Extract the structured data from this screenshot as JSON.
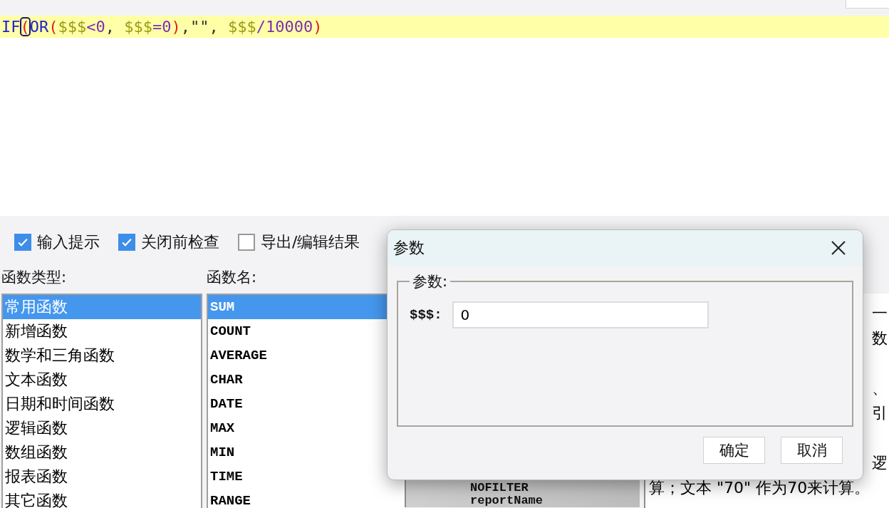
{
  "editor": {
    "tokens": [
      {
        "text": "IF",
        "kind": "function",
        "matched": false
      },
      {
        "text": "(",
        "kind": "paren",
        "matched": true
      },
      {
        "text": "OR",
        "kind": "function",
        "matched": false
      },
      {
        "text": "(",
        "kind": "paren",
        "matched": false
      },
      {
        "text": "$$$",
        "kind": "variable",
        "matched": false
      },
      {
        "text": "<",
        "kind": "operator",
        "matched": false
      },
      {
        "text": "0",
        "kind": "number",
        "matched": false
      },
      {
        "text": ", ",
        "kind": "punct",
        "matched": false
      },
      {
        "text": "$$$",
        "kind": "variable",
        "matched": false
      },
      {
        "text": "=",
        "kind": "operator",
        "matched": false
      },
      {
        "text": "0",
        "kind": "number",
        "matched": false
      },
      {
        "text": ")",
        "kind": "paren",
        "matched": false
      },
      {
        "text": ",\"\", ",
        "kind": "punct",
        "matched": false
      },
      {
        "text": "$$$",
        "kind": "variable",
        "matched": false
      },
      {
        "text": "/",
        "kind": "operator",
        "matched": false
      },
      {
        "text": "10000",
        "kind": "number",
        "matched": false
      },
      {
        "text": ")",
        "kind": "paren",
        "matched": false
      }
    ]
  },
  "options": [
    {
      "label": "输入提示",
      "checked": true
    },
    {
      "label": "关闭前检查",
      "checked": true
    },
    {
      "label": "导出/编辑结果",
      "checked": false
    }
  ],
  "function_types": {
    "label": "函数类型:",
    "items": [
      {
        "label": "常用函数",
        "selected": true
      },
      {
        "label": "新增函数",
        "selected": false
      },
      {
        "label": "数学和三角函数",
        "selected": false
      },
      {
        "label": "文本函数",
        "selected": false
      },
      {
        "label": "日期和时间函数",
        "selected": false
      },
      {
        "label": "逻辑函数",
        "selected": false
      },
      {
        "label": "数组函数",
        "selected": false
      },
      {
        "label": "报表函数",
        "selected": false
      },
      {
        "label": "其它函数",
        "selected": false
      }
    ]
  },
  "function_names": {
    "label": "函数名:",
    "items": [
      {
        "label": "SUM",
        "selected": true
      },
      {
        "label": "COUNT",
        "selected": false
      },
      {
        "label": "AVERAGE",
        "selected": false
      },
      {
        "label": "CHAR",
        "selected": false
      },
      {
        "label": "DATE",
        "selected": false
      },
      {
        "label": "MAX",
        "selected": false
      },
      {
        "label": "MIN",
        "selected": false
      },
      {
        "label": "TIME",
        "selected": false
      },
      {
        "label": "RANGE",
        "selected": false
      }
    ]
  },
  "tree": {
    "items": [
      "NOFILTER",
      "reportName"
    ]
  },
  "description": {
    "lines": [
      "一",
      "数",
      "、",
      "引",
      "逻",
      "算；文本 \"70\" 作为70来计算。"
    ]
  },
  "dialog": {
    "title": "参数",
    "group_label": "参数:",
    "params": [
      {
        "label": "$$$:",
        "value": "0"
      }
    ],
    "buttons": [
      "确定",
      "取消"
    ]
  }
}
